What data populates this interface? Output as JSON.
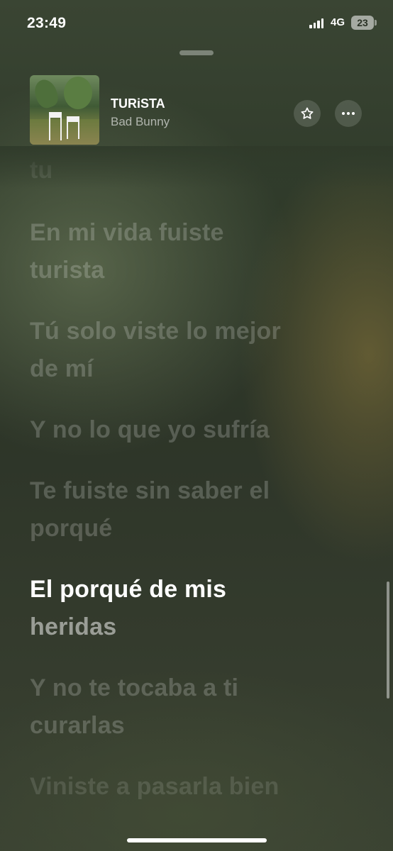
{
  "status": {
    "time": "23:49",
    "network": "4G",
    "battery": "23"
  },
  "now_playing": {
    "title": "TURiSTA",
    "artist": "Bad Bunny",
    "artwork_icon": "album-art-chairs"
  },
  "actions": {
    "favorite_icon": "star-icon",
    "more_icon": "ellipsis-icon"
  },
  "lyrics": {
    "partial_top": "tu",
    "l1": [
      "En mi vida fuiste",
      "turista"
    ],
    "l2": [
      "Tú solo viste lo mejor",
      "de mí"
    ],
    "l3": [
      "Y no lo que yo sufría"
    ],
    "l4": [
      "Te fuiste sin saber el",
      "porqué"
    ],
    "active": {
      "sung": "El porqué de mis",
      "upcoming": "heridas"
    },
    "l6": [
      "Y no te tocaba a ti",
      "curarlas"
    ],
    "l7": [
      "Viniste a pasarla bien"
    ]
  }
}
